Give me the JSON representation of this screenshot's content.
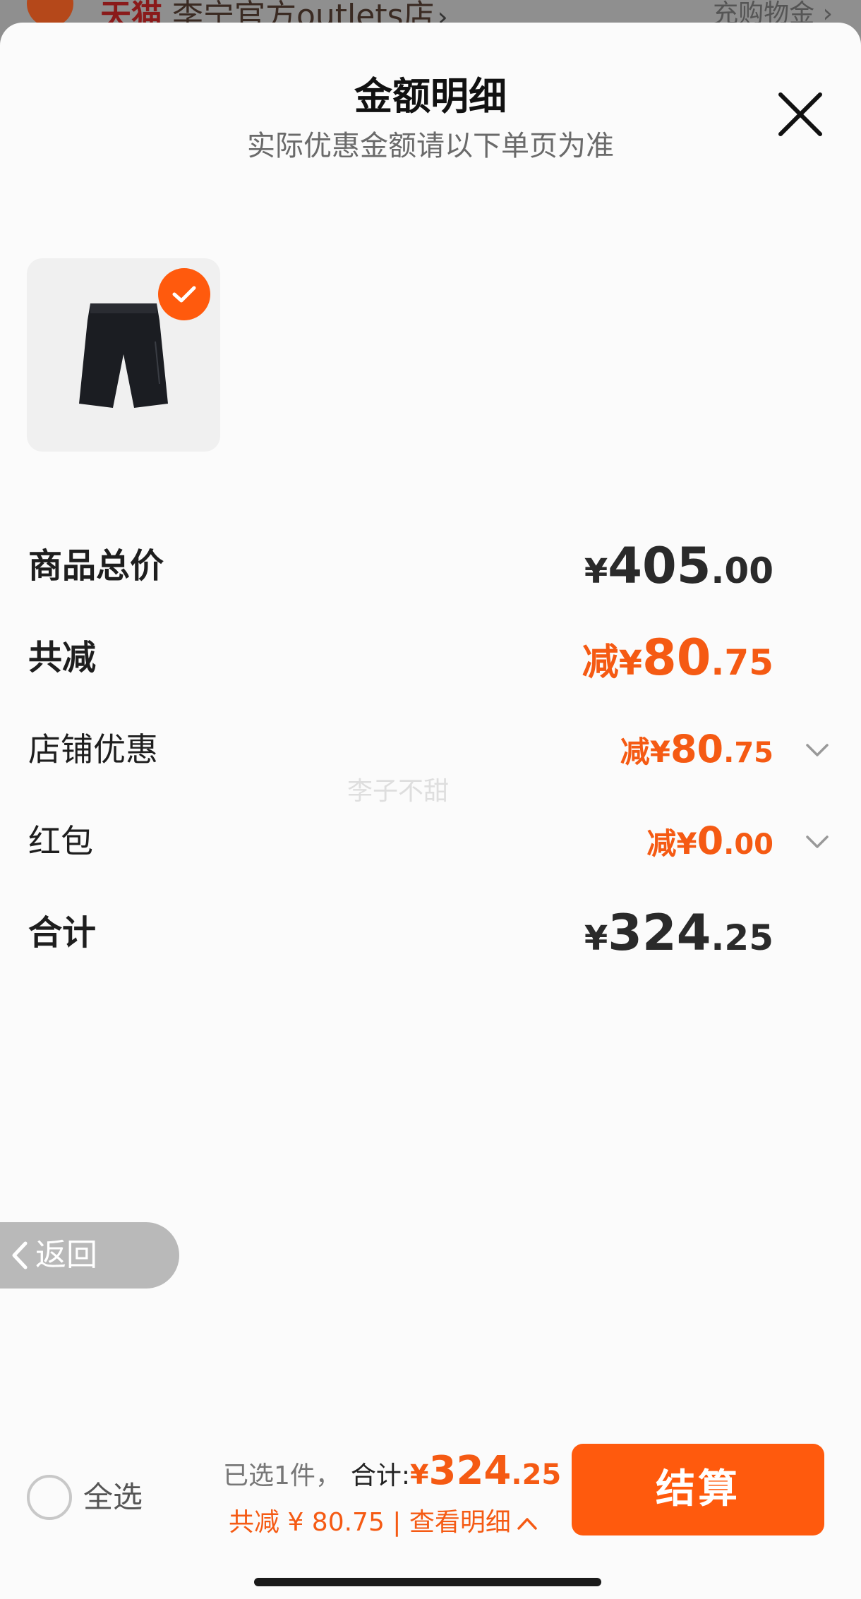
{
  "store_header": {
    "brand": "天猫",
    "store_name": "李宁官方outlets店",
    "right_link": "充购物金"
  },
  "sheet": {
    "title": "金额明细",
    "subtitle": "实际优惠金额请以下单页为准"
  },
  "rows": {
    "goods_total": {
      "label": "商品总价",
      "currency": "¥",
      "int": "405",
      "dec": ".00"
    },
    "total_discount": {
      "label": "共减",
      "prefix": "减",
      "currency": "¥",
      "int": "80",
      "dec": ".75"
    },
    "store_discount": {
      "label": "店铺优惠",
      "prefix": "减",
      "currency": "¥",
      "int": "80",
      "dec": ".75"
    },
    "red_packet": {
      "label": "红包",
      "prefix": "减",
      "currency": "¥",
      "int": "0",
      "dec": ".00"
    },
    "grand_total": {
      "label": "合计",
      "currency": "¥",
      "int": "324",
      "dec": ".25"
    }
  },
  "watermark": "李子不甜",
  "back_button": {
    "label": "返回"
  },
  "bottom_bar": {
    "select_all": "全选",
    "selected_count": "已选1件，",
    "total_label": "合计:",
    "currency": "¥",
    "total_int": "324",
    "total_dec": ".25",
    "savings_text": "共减 ¥ 80.75 | 查看明细",
    "checkout": "结算"
  },
  "colors": {
    "accent": "#ff5a0d",
    "price_orange": "#f55a13",
    "sheet_bg": "#fbfbfb"
  }
}
